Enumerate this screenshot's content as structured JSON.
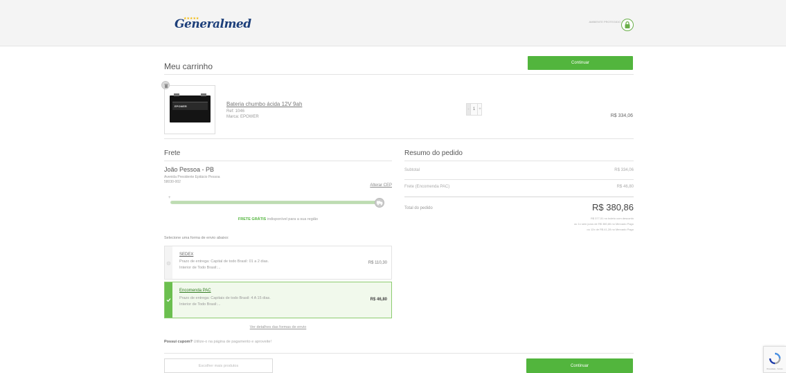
{
  "header": {
    "logo_text": "Generalmed",
    "logo_stars": "★★★★★",
    "secure_label": "AMBIENTE PROTEGIDO"
  },
  "cart": {
    "title": "Meu carrinho",
    "continue_top": "Continuar",
    "item": {
      "name": "Bateria chumbo ácida 12V 9ah",
      "ref": "Ref: 1046",
      "brand": "Marca: EPOWER",
      "image_label": "EPOWER",
      "quantity": "1",
      "minus": "-",
      "plus": "+",
      "price": "R$ 334,06"
    }
  },
  "shipping": {
    "title": "Frete",
    "city": "João Pessoa - PB",
    "address": "Avenida Presidente Epitácio Pessoa",
    "cep": "58030-002",
    "change_cep": "Alterar CEP",
    "progress_start": "+",
    "progress_fraction": 1.0,
    "free_bold": "FRETE GRÁTIS",
    "free_rest": " indisponível para a sua região",
    "select_label": "Selecione uma forma de envio abaixo:",
    "options": [
      {
        "name": "SEDEX",
        "desc_line1": "Prazo de entrega: Capital de todo Brasil: 01 a 2 dias.",
        "desc_line2": "Interior de Todo Brasil:...",
        "price": "R$ 110,30",
        "selected": false
      },
      {
        "name": "Encomenda PAC",
        "desc_line1": "Prazo de entrega: Capitais de todo Brasil: 4 A 15 dias.",
        "desc_line2": "Interior de Todo Brasil:...",
        "price": "R$ 46,80",
        "selected": true
      }
    ],
    "see_details": "Ver detalhes das formas de envio",
    "coupon_bold": "Possui cupom?",
    "coupon_rest": " Utilize-o na página de pagamento e aproveite!",
    "choose_more": "Escolher mais produtos",
    "continue_bottom": "Continuar"
  },
  "summary": {
    "title": "Resumo do pedido",
    "subtotal_label": "Subtotal",
    "subtotal_value": "R$ 334,06",
    "shipping_label": "Frete (Encomenda PAC)",
    "shipping_value": "R$ 46,80",
    "total_label": "Total do pedido",
    "total_value": "R$ 380,86",
    "note_line1": "R$ 377,51 no boleto com desconto",
    "note_line2": "ou 1x sem juros de R$ 380,86 no Mercado Pago",
    "note_line3": "ou 12x de R$ 41,28 no Mercado Pago"
  },
  "recaptcha": {
    "text": "Privacidade - Termos"
  },
  "colors": {
    "accent_green": "#52b53d",
    "brand_blue": "#1d3f7a"
  }
}
